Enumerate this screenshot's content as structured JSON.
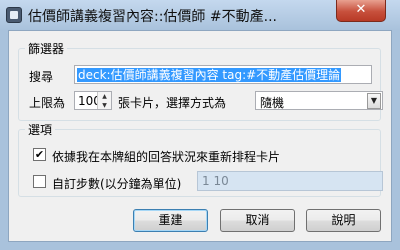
{
  "window": {
    "title": "估價師講義複習內容::估價師 #不動產...",
    "close_label": "✕"
  },
  "filter": {
    "group_label": "篩選器",
    "search_label": "搜尋",
    "search_value": "deck:估價師講義複習內容 tag:#不動產估價理論",
    "limit_label": "上限為",
    "limit_value": "100",
    "cards_label": "張卡片，選擇方式為",
    "selection_value": "隨機"
  },
  "options": {
    "group_label": "選項",
    "reschedule_label": "依據我在本牌組的回答狀況來重新排程卡片",
    "reschedule_checked": true,
    "custom_steps_label": "自訂步數(以分鐘為單位)",
    "custom_steps_checked": false,
    "steps_value": "1 10"
  },
  "buttons": {
    "rebuild": "重建",
    "cancel": "取消",
    "help": "說明"
  },
  "icons": {
    "app": "anki-app-icon",
    "check": "✔",
    "spin_up": "▲",
    "spin_down": "▼",
    "combo": "▼"
  }
}
